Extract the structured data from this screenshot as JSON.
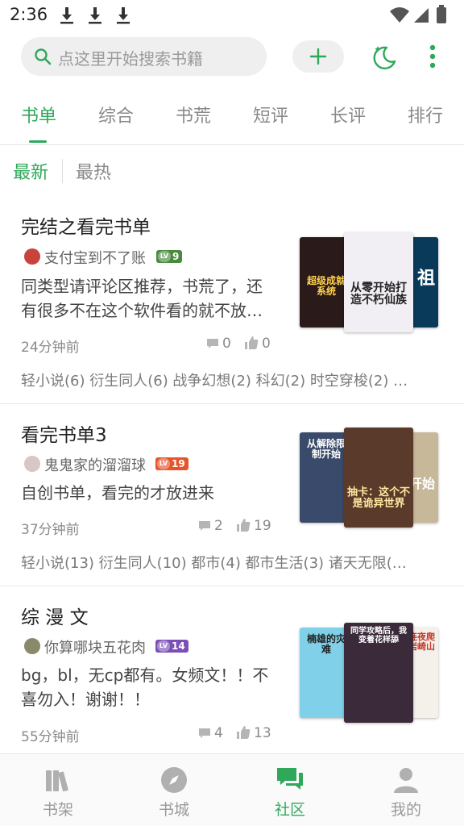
{
  "status_bar": {
    "time": "2:36"
  },
  "search": {
    "placeholder": "点这里开始搜索书籍"
  },
  "tabs": [
    "书单",
    "综合",
    "书荒",
    "短评",
    "长评",
    "排行"
  ],
  "active_tab": "书单",
  "subfilter": {
    "latest": "最新",
    "hottest": "最热"
  },
  "cards": [
    {
      "title": "完结之看完书单",
      "user": "支付宝到不了账",
      "level": "9",
      "level_color": "#4a8a3f",
      "description": "同类型请评论区推荐，书荒了，还有很多不在这个软件看的就不放…",
      "time": "24分钟前",
      "comments": "0",
      "likes": "0",
      "tags": "轻小说(6) 衍生同人(6) 战争幻想(2) 科幻(2) 时空穿梭(2) …",
      "covers": [
        {
          "text": "超级成就系统",
          "bg": "#2b1a1a",
          "fg": "#ffd24a"
        },
        {
          "text": "从零开始打造不朽仙族",
          "bg": "#f1eef4",
          "fg": "#222222"
        },
        {
          "text": "祖",
          "bg": "#0a3a5a",
          "fg": "#ffffff"
        }
      ]
    },
    {
      "title": "看完书单3",
      "user": "鬼鬼家的溜溜球",
      "level": "19",
      "level_color": "#e8542a",
      "description": "自创书单，看完的才放进来",
      "time": "37分钟前",
      "comments": "2",
      "likes": "19",
      "tags": "轻小说(13) 衍生同人(10) 都市(4) 都市生活(3) 诸天无限(…",
      "covers": [
        {
          "text": "从解除限制开始",
          "bg": "#3a4a6a",
          "fg": "#ffffff"
        },
        {
          "text": "抽卡：这个不是诡异世界",
          "bg": "#5a3a2a",
          "fg": "#ffe7a0"
        },
        {
          "text": "开始",
          "bg": "#c8b89a",
          "fg": "#ffffff"
        }
      ]
    },
    {
      "title": "综 漫 文",
      "user": "你算哪块五花肉",
      "level": "14",
      "level_color": "#7b4fb8",
      "description": "bg，bl，无cp都有。女频文！！不喜勿入！谢谢！！",
      "time": "55分钟前",
      "comments": "4",
      "likes": "13",
      "tags": "",
      "covers": [
        {
          "text": "楠雄的灾难",
          "bg": "#7fd0e8",
          "fg": "#222222"
        },
        {
          "text": "同学攻略后，我变着花样舔",
          "bg": "#3a2a3a",
          "fg": "#ffffff"
        },
        {
          "text": "太宰连夜爬上了岩崎山",
          "bg": "#f4f0ea",
          "fg": "#c0392b"
        }
      ]
    }
  ],
  "bottom_nav": [
    {
      "label": "书架",
      "icon": "bookshelf-icon"
    },
    {
      "label": "书城",
      "icon": "compass-icon"
    },
    {
      "label": "社区",
      "icon": "chat-bubbles-icon"
    },
    {
      "label": "我的",
      "icon": "person-icon"
    }
  ],
  "colors": {
    "accent": "#2fa85a",
    "text": "#222222",
    "muted": "#8a8a8a"
  }
}
